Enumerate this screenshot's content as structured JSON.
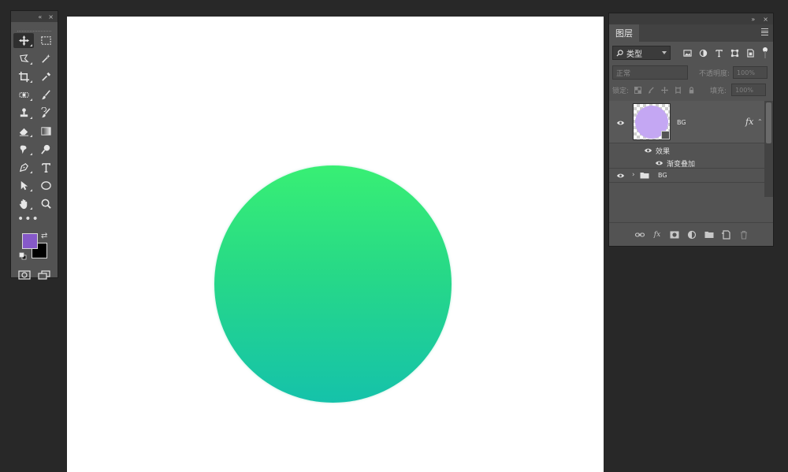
{
  "toolbox": {
    "collapse_label": "«",
    "close_label": "×",
    "more_tools": "•••",
    "tools": [
      {
        "name": "move-tool",
        "active": true
      },
      {
        "name": "rectangular-marquee-tool"
      },
      {
        "name": "lasso-tool"
      },
      {
        "name": "magic-wand-tool"
      },
      {
        "name": "crop-tool"
      },
      {
        "name": "eyedropper-tool"
      },
      {
        "name": "spot-healing-brush-tool"
      },
      {
        "name": "brush-tool"
      },
      {
        "name": "clone-stamp-tool"
      },
      {
        "name": "history-brush-tool"
      },
      {
        "name": "eraser-tool"
      },
      {
        "name": "gradient-tool"
      },
      {
        "name": "smudge-tool"
      },
      {
        "name": "dodge-tool"
      },
      {
        "name": "pen-tool"
      },
      {
        "name": "type-tool"
      },
      {
        "name": "path-selection-tool"
      },
      {
        "name": "ellipse-tool"
      },
      {
        "name": "hand-tool"
      },
      {
        "name": "zoom-tool"
      }
    ],
    "foreground_color": "#8659c8",
    "background_color": "#000000"
  },
  "canvas": {
    "background": "#ffffff",
    "shape_gradient_top": "#38ef74",
    "shape_gradient_bottom": "#15c2aa"
  },
  "layers_panel": {
    "collapse_label": "»",
    "close_label": "×",
    "tab_label": "图层",
    "filter_kind": "类型",
    "blend_mode": "正常",
    "opacity_label": "不透明度:",
    "opacity_value": "100%",
    "lock_label": "锁定:",
    "fill_label": "填充:",
    "fill_value": "100%",
    "layers": {
      "shape_layer_name": "BG",
      "shape_thumb_color": "#c4a7f3",
      "fx_label": "fx",
      "effects_label": "效果",
      "gradient_overlay_label": "渐变叠加",
      "group_name": "BG"
    }
  }
}
